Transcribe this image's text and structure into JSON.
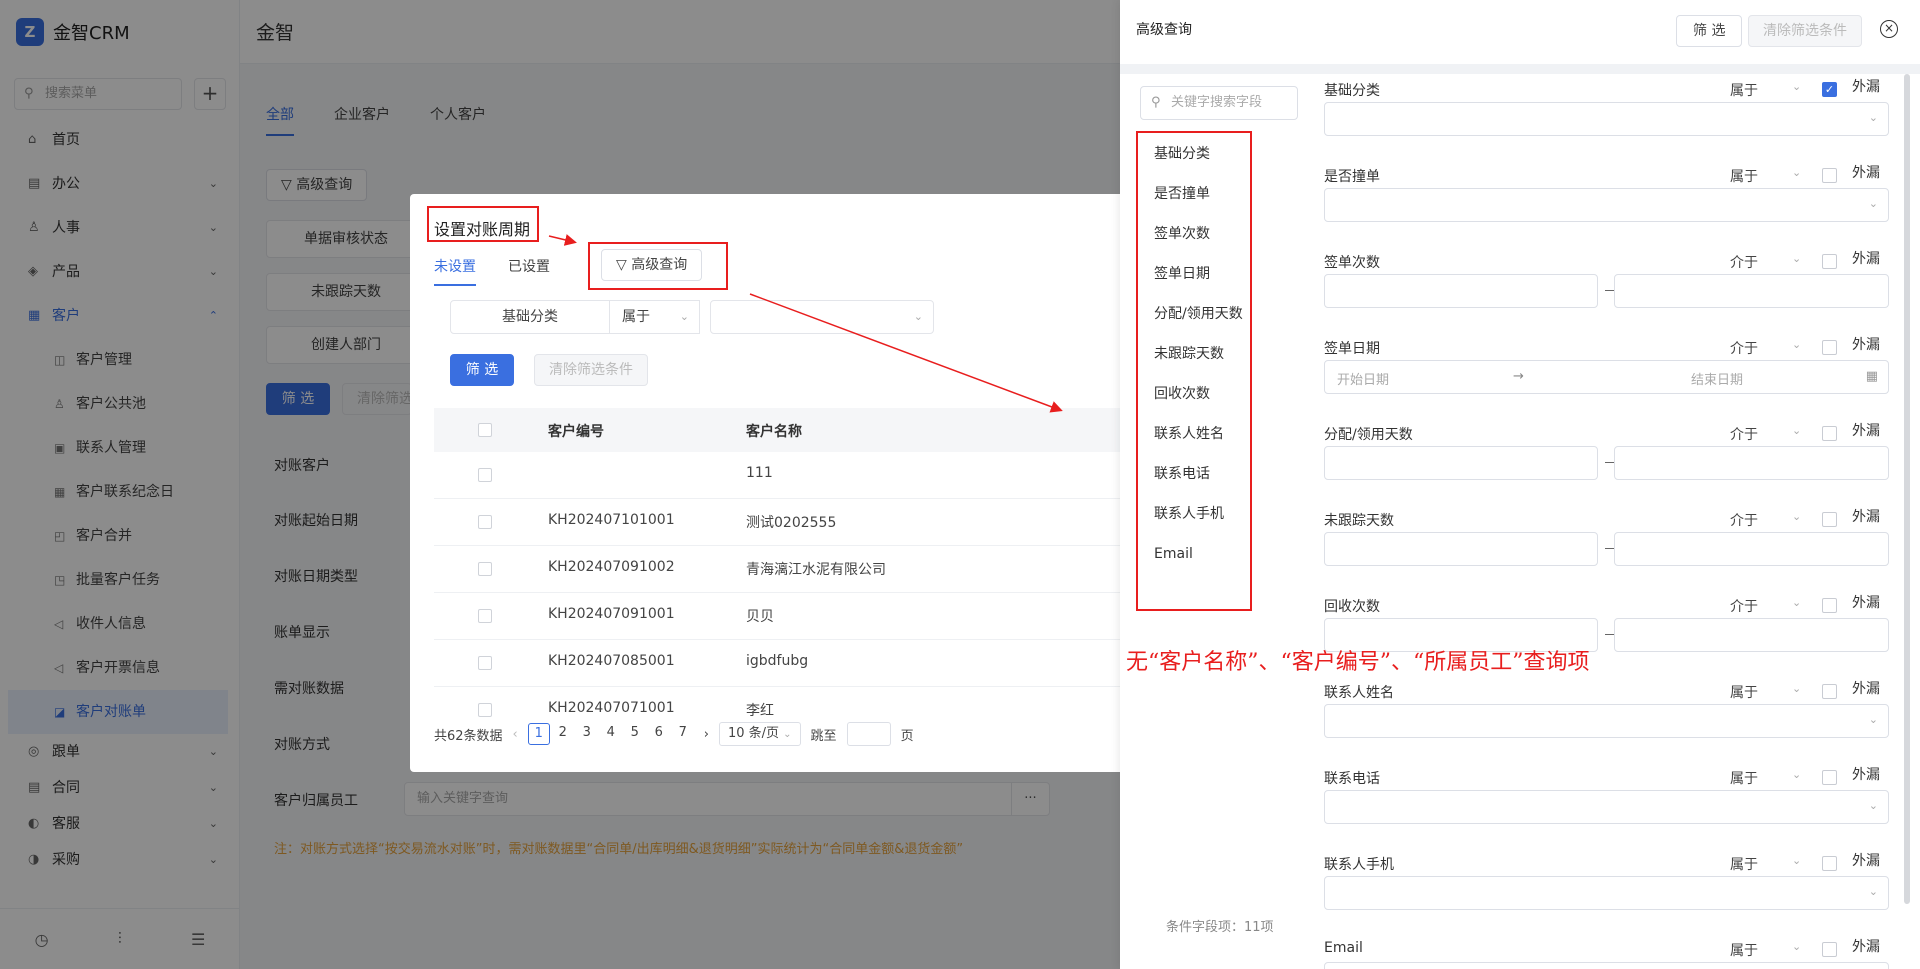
{
  "sidebar": {
    "logo": "金智CRM",
    "logo_mark": "Z",
    "search_placeholder": "搜索菜单",
    "plus": "+",
    "items": [
      {
        "label": "首页",
        "icon": "home-icon",
        "glyph": "⌂",
        "chev": ""
      },
      {
        "label": "办公",
        "icon": "briefcase-icon",
        "glyph": "▤",
        "chev": "⌄"
      },
      {
        "label": "人事",
        "icon": "people-icon",
        "glyph": "♙",
        "chev": "⌄"
      },
      {
        "label": "产品",
        "icon": "cube-icon",
        "glyph": "◈",
        "chev": "⌄"
      },
      {
        "label": "客户",
        "icon": "customer-icon",
        "glyph": "▦",
        "chev": "⌃"
      }
    ],
    "sub_items": [
      {
        "label": "客户管理",
        "glyph": "◫"
      },
      {
        "label": "客户公共池",
        "glyph": "♙"
      },
      {
        "label": "联系人管理",
        "glyph": "▣"
      },
      {
        "label": "客户联系纪念日",
        "glyph": "▦"
      },
      {
        "label": "客户合并",
        "glyph": "◰"
      },
      {
        "label": "批量客户任务",
        "glyph": "◳"
      },
      {
        "label": "收件人信息",
        "glyph": "◁"
      },
      {
        "label": "客户开票信息",
        "glyph": "◁"
      },
      {
        "label": "客户对账单",
        "glyph": "◪"
      }
    ],
    "lower_items": [
      {
        "label": "跟单",
        "glyph": "◎"
      },
      {
        "label": "合同",
        "glyph": "▤"
      },
      {
        "label": "客服",
        "glyph": "◐"
      },
      {
        "label": "采购",
        "glyph": "◑"
      }
    ],
    "bottom_icons": [
      "◷",
      "⫶",
      "☰"
    ]
  },
  "header": {
    "title": "金智"
  },
  "main": {
    "tabs": [
      "全部",
      "企业客户",
      "个人客户"
    ],
    "adv_query": "高级查询",
    "filter_fields": [
      "单据审核状态",
      "未跟踪天数",
      "创建人部门"
    ],
    "filter_btn": "筛 选",
    "clear_btn": "清除筛选",
    "form_labels": [
      "对账客户",
      "对账起始日期",
      "对账日期类型",
      "账单显示",
      "需对账数据",
      "对账方式",
      "客户归属员工"
    ],
    "owner_placeholder": "输入关键字查询",
    "owner_dots": "···",
    "note": "注：对账方式选择“按交易流水对账”时，需对账数据里“合同单/出库明细&退货明细”实际统计为“合同单金额&退货金额”"
  },
  "dialog": {
    "title": "设置对账周期",
    "tabs": [
      "未设置",
      "已设置"
    ],
    "adv_query": "高级查询",
    "filter_field": "基础分类",
    "filter_op": "属于",
    "filter_btn": "筛 选",
    "clear_btn": "清除筛选条件",
    "columns": [
      "客户编号",
      "客户名称"
    ],
    "rows": [
      {
        "code": "",
        "name": "111"
      },
      {
        "code": "KH202407101001",
        "name": "测试0202555"
      },
      {
        "code": "KH202407091002",
        "name": "青海漓江水泥有限公司"
      },
      {
        "code": "KH202407091001",
        "name": "贝贝"
      },
      {
        "code": "KH202407085001",
        "name": "igbdfubg"
      },
      {
        "code": "KH202407071001",
        "name": "李红"
      }
    ],
    "pager": {
      "total": "共62条数据",
      "pages": [
        "1",
        "2",
        "3",
        "4",
        "5",
        "6",
        "7"
      ],
      "page_size": "10 条/页",
      "goto": "跳至",
      "page_unit": "页"
    }
  },
  "annotation": "无“客户名称”、“客户编号”、“所属员工”查询项",
  "panel": {
    "title": "高级查询",
    "filter_btn": "筛 选",
    "clear_btn": "清除筛选条件",
    "close": "×",
    "search_placeholder": "关键字搜索字段",
    "field_list": [
      "基础分类",
      "是否撞单",
      "签单次数",
      "签单日期",
      "分配/领用天数",
      "未跟踪天数",
      "回收次数",
      "联系人姓名",
      "联系电话",
      "联系人手机",
      "Email"
    ],
    "count": "条件字段项：11项",
    "ext_label": "外漏",
    "forms": [
      {
        "label": "基础分类",
        "op": "属于",
        "kind": "select",
        "checked": true
      },
      {
        "label": "是否撞单",
        "op": "属于",
        "kind": "select",
        "checked": false
      },
      {
        "label": "签单次数",
        "op": "介于",
        "kind": "range",
        "checked": false
      },
      {
        "label": "签单日期",
        "op": "介于",
        "kind": "date",
        "checked": false
      },
      {
        "label": "分配/领用天数",
        "op": "介于",
        "kind": "range",
        "checked": false
      },
      {
        "label": "未跟踪天数",
        "op": "介于",
        "kind": "range",
        "checked": false
      },
      {
        "label": "回收次数",
        "op": "介于",
        "kind": "range",
        "checked": false
      },
      {
        "label": "联系人姓名",
        "op": "属于",
        "kind": "select",
        "checked": false
      },
      {
        "label": "联系电话",
        "op": "属于",
        "kind": "select",
        "checked": false
      },
      {
        "label": "联系人手机",
        "op": "属于",
        "kind": "select",
        "checked": false
      },
      {
        "label": "Email",
        "op": "属于",
        "kind": "select",
        "checked": false
      }
    ],
    "date_start": "开始日期",
    "date_end": "结束日期",
    "date_arrow": "→",
    "calendar_glyph": "▦"
  },
  "colors": {
    "accent": "#3a6fe0",
    "annotation": "#e81e1e",
    "warning": "#e6a23c"
  }
}
